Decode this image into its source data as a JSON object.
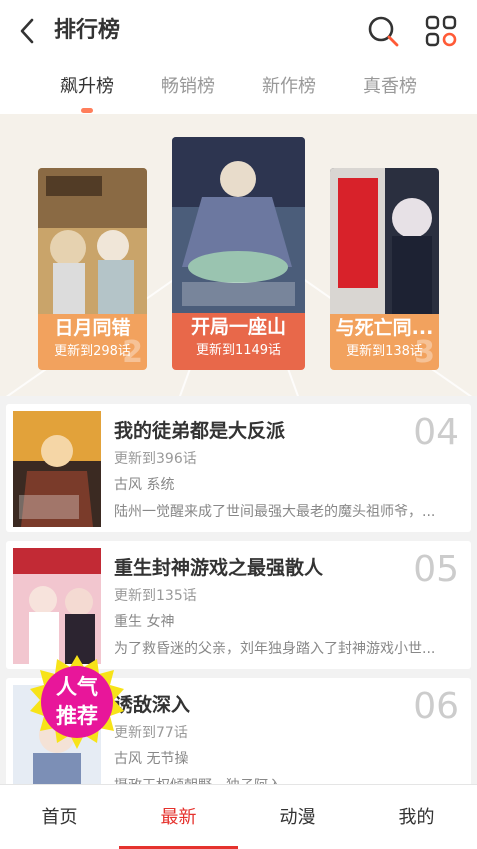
{
  "header": {
    "title": "排行榜"
  },
  "tabs": [
    {
      "label": "飙升榜"
    },
    {
      "label": "畅销榜"
    },
    {
      "label": "新作榜"
    },
    {
      "label": "真香榜"
    }
  ],
  "podium": [
    {
      "name": "日月同错",
      "update": "更新到298话",
      "rank": "2"
    },
    {
      "name": "开局一座山",
      "update": "更新到1149话",
      "rank": "1"
    },
    {
      "name": "与死亡同...",
      "update": "更新到138话",
      "rank": "3"
    }
  ],
  "list": [
    {
      "title": "我的徒弟都是大反派",
      "update": "更新到396话",
      "tags": "古风 系统",
      "desc": "陆州一觉醒来成了世间最强大最老的魔头祖师爷，...",
      "rank": "04"
    },
    {
      "title": "重生封神游戏之最强散人",
      "update": "更新到135话",
      "tags": "重生 女神",
      "desc": "为了救昏迷的父亲，刘年独身踏入了封神游戏小世...",
      "rank": "05"
    },
    {
      "title": "诱敌深入",
      "update": "更新到77话",
      "tags": "古风 无节操",
      "desc": "摄政王权倾朝野，独子阿入...",
      "rank": "06"
    }
  ],
  "badge": {
    "line1": "人气",
    "line2": "推荐"
  },
  "bottom_nav": [
    {
      "label": "首页"
    },
    {
      "label": "最新"
    },
    {
      "label": "动漫"
    },
    {
      "label": "我的"
    }
  ],
  "colors": {
    "accent": "#e5322d",
    "tab_indicator": "#ff7e5b",
    "podium_gold": "#f2a25e",
    "podium_red": "#e8684a"
  }
}
